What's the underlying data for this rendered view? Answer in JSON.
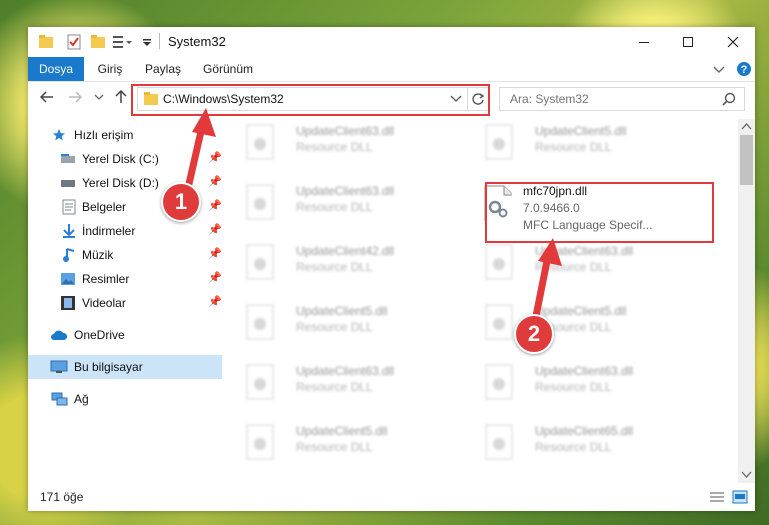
{
  "window": {
    "title": "System32"
  },
  "ribbon": {
    "tabs": [
      "Dosya",
      "Giriş",
      "Paylaş",
      "Görünüm"
    ]
  },
  "address": {
    "path": "C:\\Windows\\System32"
  },
  "search": {
    "placeholder": "Ara: System32"
  },
  "sidebar": {
    "quick_access": "Hızlı erişim",
    "items": [
      {
        "label": "Yerel Disk (C:)",
        "icon": "drive-icon"
      },
      {
        "label": "Yerel Disk (D:)",
        "icon": "drive-icon"
      },
      {
        "label": "Belgeler",
        "icon": "documents-icon"
      },
      {
        "label": "İndirmeler",
        "icon": "downloads-icon"
      },
      {
        "label": "Müzik",
        "icon": "music-icon"
      },
      {
        "label": "Resimler",
        "icon": "pictures-icon"
      },
      {
        "label": "Videolar",
        "icon": "videos-icon"
      }
    ],
    "onedrive": "OneDrive",
    "this_pc": "Bu bilgisayar",
    "network": "Ağ"
  },
  "files": {
    "left": [
      {
        "name": "UpdateClient63.dll",
        "desc": "Resource DLL"
      },
      {
        "name": "UpdateClient63.dll",
        "desc": "Resource DLL"
      },
      {
        "name": "UpdateClient42.dll",
        "desc": "Resource DLL"
      },
      {
        "name": "UpdateClient5.dll",
        "desc": "Resource DLL"
      },
      {
        "name": "UpdateClient63.dll",
        "desc": "Resource DLL"
      },
      {
        "name": "UpdateClient5.dll",
        "desc": "Resource DLL"
      }
    ],
    "right": [
      {
        "name": "UpdateClient5.dll",
        "desc": "Resource DLL"
      },
      {
        "name": "UpdateClient63.dll",
        "desc": "Resource DLL"
      },
      {
        "name": "UpdateClient5.dll",
        "desc": "Resource DLL"
      },
      {
        "name": "UpdateClient63.dll",
        "desc": "Resource DLL"
      },
      {
        "name": "UpdateClient65.dll",
        "desc": "Resource DLL"
      }
    ],
    "highlighted": {
      "name": "mfc70jpn.dll",
      "version": "7.0.9466.0",
      "desc": "MFC Language Specif..."
    }
  },
  "status": {
    "count": "171 öğe"
  },
  "annotations": {
    "badge1": "1",
    "badge2": "2",
    "color": "#e23a3a"
  }
}
